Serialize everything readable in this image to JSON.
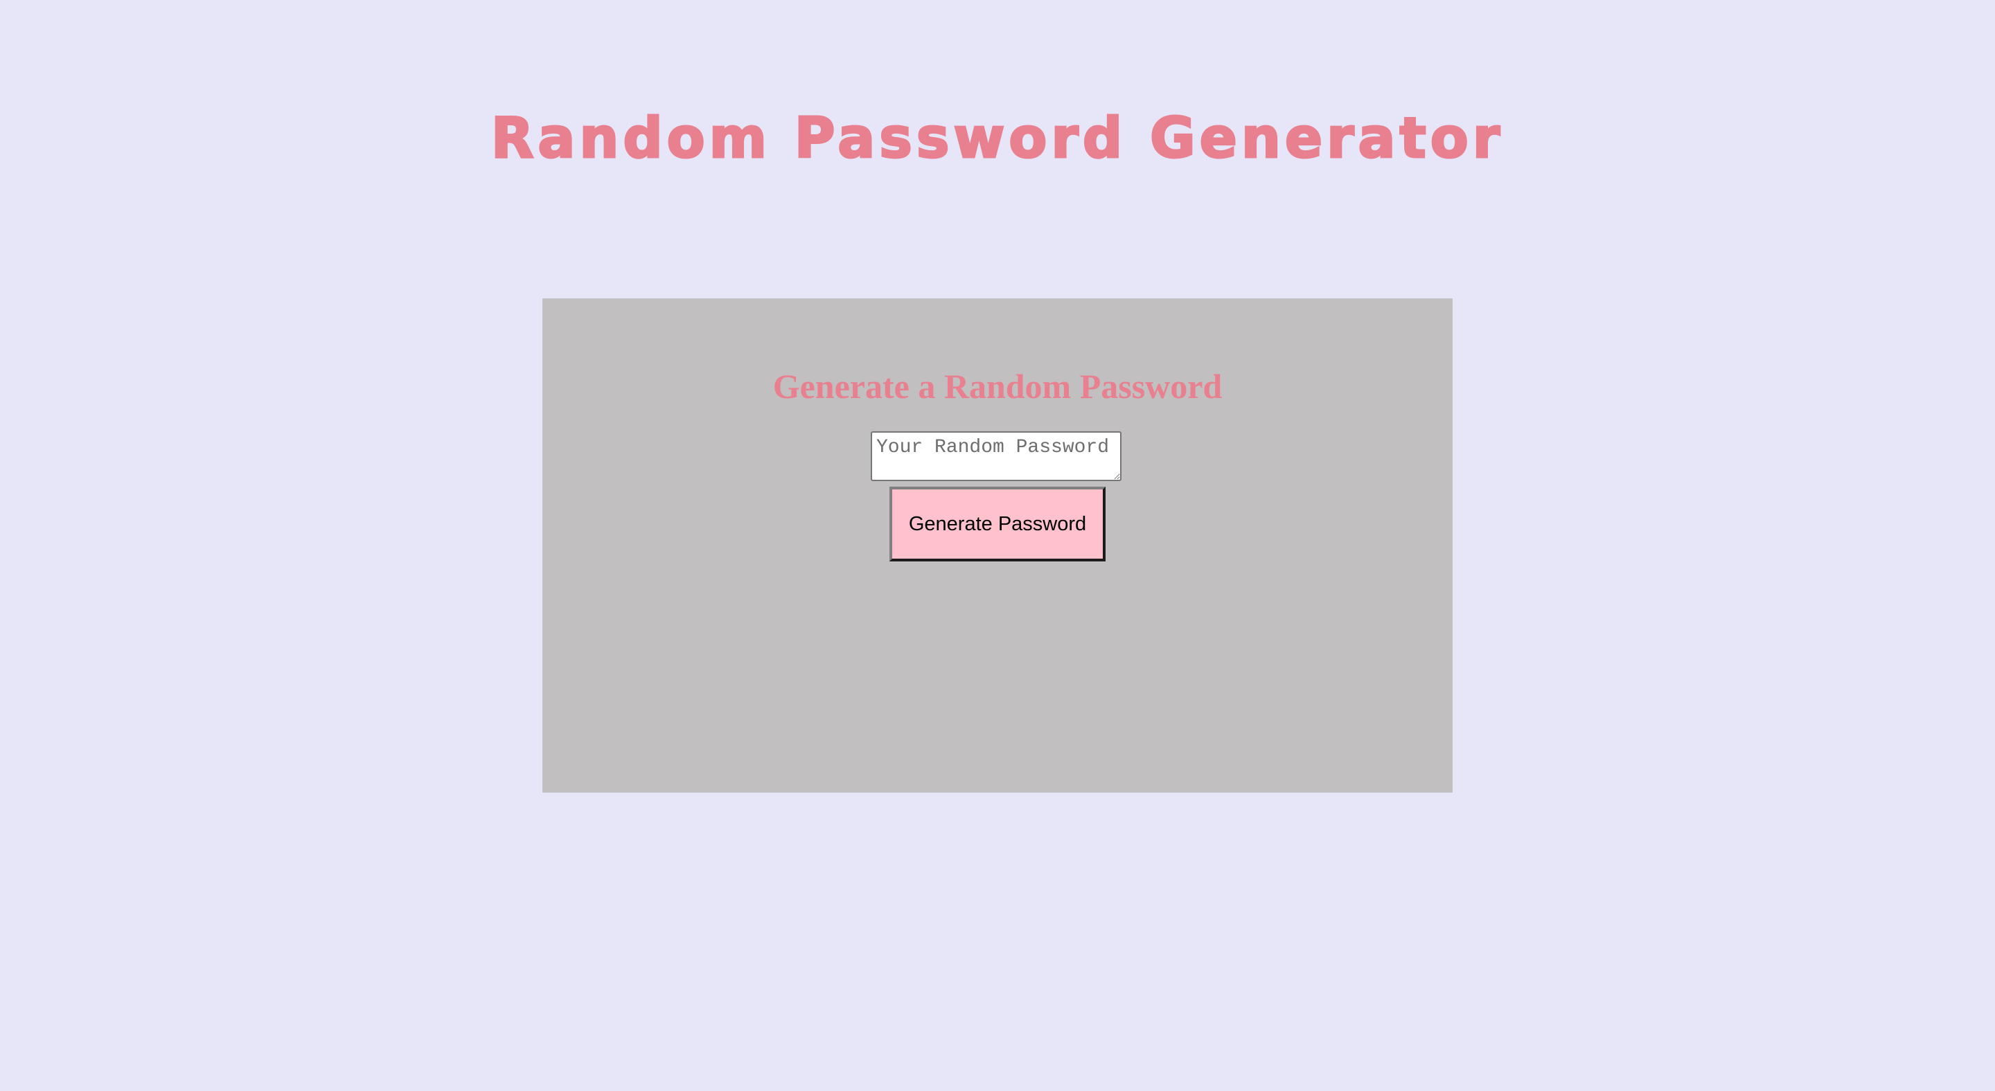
{
  "header": {
    "title": "Random Password Generator"
  },
  "card": {
    "title": "Generate a Random Password",
    "password_field": {
      "value": "",
      "placeholder": "Your Random Password"
    },
    "generate_button_label": "Generate Password"
  },
  "colors": {
    "page_background": "#e6e6f8",
    "card_background": "#c1bfc0",
    "title_accent": "#e8808f",
    "button_background": "#ffc1cb"
  }
}
